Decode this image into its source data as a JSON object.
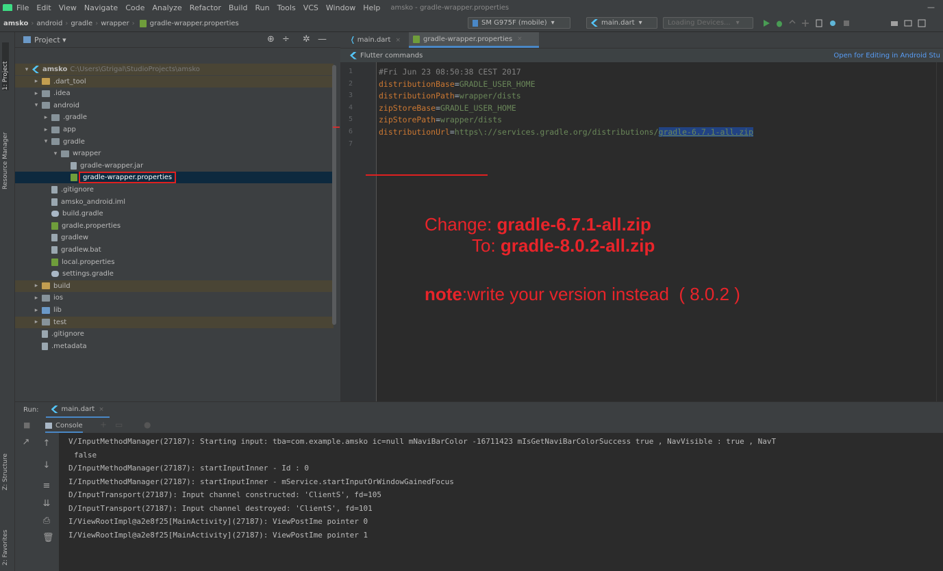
{
  "menubar": {
    "items": [
      "File",
      "Edit",
      "View",
      "Navigate",
      "Code",
      "Analyze",
      "Refactor",
      "Build",
      "Run",
      "Tools",
      "VCS",
      "Window",
      "Help"
    ],
    "underline": [
      "F",
      "E",
      "V",
      "N",
      "C",
      "z",
      "R",
      "B",
      "u",
      "T",
      "",
      "W",
      "H"
    ],
    "window_title": "amsko - gradle-wrapper.properties"
  },
  "navbar": {
    "breadcrumbs": [
      "amsko",
      "android",
      "gradle",
      "wrapper",
      "gradle-wrapper.properties"
    ],
    "device_combo": "SM G975F (mobile)",
    "run_config_combo": "main.dart",
    "loading_combo": "Loading Devices..."
  },
  "leftstrip": {
    "project_label": "1: Project",
    "resource_manager_label": "Resource Manager",
    "structure_label": "Z: Structure",
    "favorites_label": "2: Favorites"
  },
  "project": {
    "view_label": "Project",
    "tree": [
      {
        "indent": 0,
        "arrow": "▾",
        "icon": "flutter",
        "name": "amsko",
        "bold": true,
        "path": "C:\\Users\\Gtrigal\\StudioProjects\\amsko",
        "style": "hl"
      },
      {
        "indent": 1,
        "arrow": "▸",
        "icon": "folder-yellow",
        "name": ".dart_tool",
        "style": "hl"
      },
      {
        "indent": 1,
        "arrow": "▸",
        "icon": "folder",
        "name": ".idea",
        "style": ""
      },
      {
        "indent": 1,
        "arrow": "▾",
        "icon": "folder",
        "name": "android",
        "style": ""
      },
      {
        "indent": 2,
        "arrow": "▸",
        "icon": "folder",
        "name": ".gradle",
        "style": ""
      },
      {
        "indent": 2,
        "arrow": "▸",
        "icon": "folder",
        "name": "app",
        "style": ""
      },
      {
        "indent": 2,
        "arrow": "▾",
        "icon": "folder",
        "name": "gradle",
        "style": ""
      },
      {
        "indent": 3,
        "arrow": "▾",
        "icon": "folder",
        "name": "wrapper",
        "style": ""
      },
      {
        "indent": 4,
        "arrow": "",
        "icon": "file",
        "name": "gradle-wrapper.jar",
        "style": ""
      },
      {
        "indent": 4,
        "arrow": "",
        "icon": "props",
        "name": "gradle-wrapper.properties",
        "style": "sel",
        "boxed": true
      },
      {
        "indent": 2,
        "arrow": "",
        "icon": "file",
        "name": ".gitignore",
        "style": ""
      },
      {
        "indent": 2,
        "arrow": "",
        "icon": "file",
        "name": "amsko_android.iml",
        "style": ""
      },
      {
        "indent": 2,
        "arrow": "",
        "icon": "gradle",
        "name": "build.gradle",
        "style": ""
      },
      {
        "indent": 2,
        "arrow": "",
        "icon": "props",
        "name": "gradle.properties",
        "style": ""
      },
      {
        "indent": 2,
        "arrow": "",
        "icon": "file",
        "name": "gradlew",
        "style": ""
      },
      {
        "indent": 2,
        "arrow": "",
        "icon": "file",
        "name": "gradlew.bat",
        "style": ""
      },
      {
        "indent": 2,
        "arrow": "",
        "icon": "props",
        "name": "local.properties",
        "style": ""
      },
      {
        "indent": 2,
        "arrow": "",
        "icon": "gradle",
        "name": "settings.gradle",
        "style": ""
      },
      {
        "indent": 1,
        "arrow": "▸",
        "icon": "folder-yellow",
        "name": "build",
        "style": "hl"
      },
      {
        "indent": 1,
        "arrow": "▸",
        "icon": "folder",
        "name": "ios",
        "style": ""
      },
      {
        "indent": 1,
        "arrow": "▸",
        "icon": "folder-blue",
        "name": "lib",
        "style": ""
      },
      {
        "indent": 1,
        "arrow": "▸",
        "icon": "folder",
        "name": "test",
        "style": "hl"
      },
      {
        "indent": 1,
        "arrow": "",
        "icon": "file",
        "name": ".gitignore",
        "style": ""
      },
      {
        "indent": 1,
        "arrow": "",
        "icon": "file",
        "name": ".metadata",
        "style": ""
      }
    ]
  },
  "editor": {
    "tabs": [
      {
        "label": "main.dart",
        "active": false
      },
      {
        "label": "gradle-wrapper.properties",
        "active": true
      }
    ],
    "info_left": "Flutter commands",
    "info_right": "Open for Editing in Android Stu",
    "lines": [
      {
        "no": "1",
        "key": "",
        "val": "#Fri Jun 23 08:50:38 CEST 2017",
        "comment": true
      },
      {
        "no": "2",
        "key": "distributionBase",
        "val": "GRADLE_USER_HOME"
      },
      {
        "no": "3",
        "key": "distributionPath",
        "val": "wrapper/dists"
      },
      {
        "no": "4",
        "key": "zipStoreBase",
        "val": "GRADLE_USER_HOME"
      },
      {
        "no": "5",
        "key": "zipStorePath",
        "val": "wrapper/dists"
      },
      {
        "no": "6",
        "key": "distributionUrl",
        "val": "https\\://services.gradle.org/distributions/",
        "selected": "gradle-6.7.1-all.zip"
      },
      {
        "no": "7",
        "key": "",
        "val": ""
      }
    ],
    "annotation": {
      "change_label": "Change: ",
      "change_value": "gradle-6.7.1-all.zip",
      "to_label": "To: ",
      "to_value": "gradle-8.0.2-all.zip",
      "note_label": "note",
      "note_text": ":write your version instead  ( 8.0.2 )"
    }
  },
  "run": {
    "label": "Run:",
    "tab": "main.dart",
    "console_label": "Console",
    "lines": [
      "V/InputMethodManager(27187): Starting input: tba=com.example.amsko ic=null mNaviBarColor -16711423 mIsGetNaviBarColorSuccess true , NavVisible : true , NavT",
      "false",
      "D/InputMethodManager(27187): startInputInner - Id : 0",
      "I/InputMethodManager(27187): startInputInner - mService.startInputOrWindowGainedFocus",
      "D/InputTransport(27187): Input channel constructed: 'ClientS', fd=105",
      "D/InputTransport(27187): Input channel destroyed: 'ClientS', fd=101",
      "I/ViewRootImpl@a2e8f25[MainActivity](27187): ViewPostIme pointer 0",
      "I/ViewRootImpl@a2e8f25[MainActivity](27187): ViewPostIme pointer 1"
    ]
  }
}
